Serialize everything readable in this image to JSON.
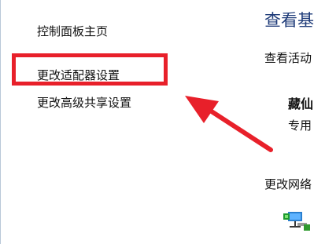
{
  "sidebar": {
    "items": [
      {
        "label": "控制面板主页"
      },
      {
        "label": "更改适配器设置"
      },
      {
        "label": "更改高级共享设置"
      }
    ]
  },
  "main": {
    "title": "查看基",
    "active_label": "查看活动",
    "network_name": "藏仙",
    "network_type": "专用",
    "change_settings": "更改网络"
  },
  "annotation": {
    "box_color": "#e8202a",
    "arrow_color": "#e8202a"
  },
  "icons": {
    "network_icon": "network-adapter-icon"
  }
}
